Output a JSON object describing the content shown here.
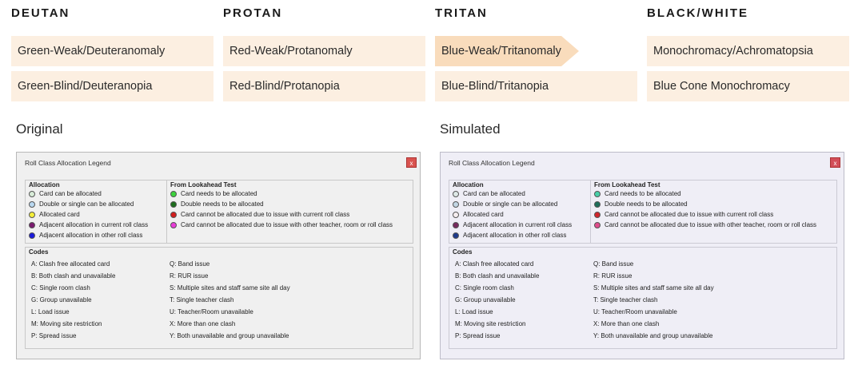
{
  "columns": [
    {
      "heading": "DEUTAN",
      "options": [
        "Green-Weak/Deuteranomaly",
        "Green-Blind/Deuteranopia"
      ]
    },
    {
      "heading": "PROTAN",
      "options": [
        "Red-Weak/Protanomaly",
        "Red-Blind/Protanopia"
      ]
    },
    {
      "heading": "TRITAN",
      "options": [
        "Blue-Weak/Tritanomaly",
        "Blue-Blind/Tritanopia"
      ]
    },
    {
      "heading": "BLACK/WHITE",
      "options": [
        "Monochromacy/Achromatopsia",
        "Blue Cone Monochromacy"
      ]
    }
  ],
  "selected_option": "Blue-Weak/Tritanomaly",
  "original_label": "Original",
  "simulated_label": "Simulated",
  "window": {
    "title": "Roll Class Allocation Legend",
    "close": "x",
    "allocation_title": "Allocation",
    "lookahead_title": "From Lookahead Test",
    "codes_title": "Codes",
    "allocation": [
      "Card can be allocated",
      "Double or single can be allocated",
      "Allocated card",
      "Adjacent allocation in current roll class",
      "Adjacent allocation in other roll class"
    ],
    "lookahead": [
      "Card needs to be allocated",
      "Double needs to be allocated",
      "Card cannot be allocated due to issue with current roll class",
      "Card cannot be allocated due to issue with other teacher, room or roll class"
    ],
    "codes_left": [
      "A: Clash free allocated card",
      "B: Both clash and unavailable",
      "C: Single room clash",
      "G: Group unavailable",
      "L: Load issue",
      "M: Moving site restriction",
      "P: Spread issue"
    ],
    "codes_right": [
      "Q: Band issue",
      "R: RUR issue",
      "S: Multiple sites and staff same site all day",
      "T: Single teacher clash",
      "U: Teacher/Room unavailable",
      "X: More than one clash",
      "Y: Both unavailable and group unavailable"
    ]
  },
  "colors": {
    "original_allocation": [
      "#d8ecd8",
      "#b9d8f0",
      "#f4ee3a",
      "#7a1a6e",
      "#1a1adc"
    ],
    "original_lookahead": [
      "#3cd23c",
      "#1e6e1e",
      "#d21e1e",
      "#e83cd8"
    ],
    "simulated_allocation": [
      "#dde8e6",
      "#c2d6e4",
      "#f6eef0",
      "#762a5e",
      "#1e3a8c"
    ],
    "simulated_lookahead": [
      "#48d0a8",
      "#1e6e5a",
      "#d0242c",
      "#e04c8c"
    ],
    "option_bg": "#fcefe1",
    "option_selected_bg": "#f9dcbc"
  }
}
